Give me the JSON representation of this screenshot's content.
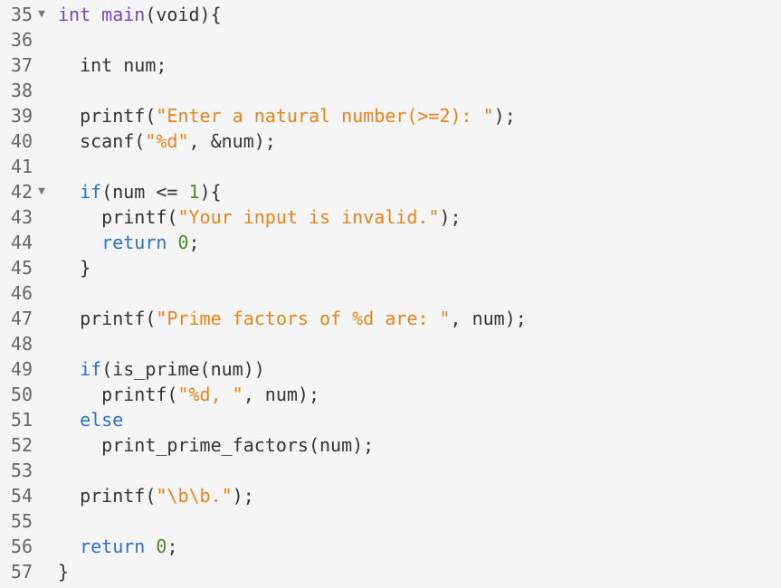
{
  "colors": {
    "background": "#f5f5f5",
    "gutter_text": "#666666",
    "plain": "#333333",
    "keyword": "#7b46b8",
    "control": "#2b72c8",
    "string": "#e8831c",
    "number": "#4d8a2c"
  },
  "fold_icon": "triangle-down-icon",
  "lines": [
    {
      "n": "35",
      "fold": "▼",
      "tokens": [
        {
          "t": "int",
          "c": "kw"
        },
        {
          "t": " ",
          "c": "pl"
        },
        {
          "t": "main",
          "c": "fn"
        },
        {
          "t": "(void){",
          "c": "pl"
        }
      ]
    },
    {
      "n": "36",
      "fold": "",
      "tokens": []
    },
    {
      "n": "37",
      "fold": "",
      "tokens": [
        {
          "t": "  int num;",
          "c": "pl"
        }
      ]
    },
    {
      "n": "38",
      "fold": "",
      "tokens": []
    },
    {
      "n": "39",
      "fold": "",
      "tokens": [
        {
          "t": "  printf(",
          "c": "pl"
        },
        {
          "t": "\"Enter a natural number(>=2): \"",
          "c": "str"
        },
        {
          "t": ");",
          "c": "pl"
        }
      ]
    },
    {
      "n": "40",
      "fold": "",
      "tokens": [
        {
          "t": "  scanf(",
          "c": "pl"
        },
        {
          "t": "\"%d\"",
          "c": "str"
        },
        {
          "t": ", &num);",
          "c": "pl"
        }
      ]
    },
    {
      "n": "41",
      "fold": "",
      "tokens": []
    },
    {
      "n": "42",
      "fold": "▼",
      "tokens": [
        {
          "t": "  ",
          "c": "pl"
        },
        {
          "t": "if",
          "c": "blue"
        },
        {
          "t": "(num <= ",
          "c": "pl"
        },
        {
          "t": "1",
          "c": "num"
        },
        {
          "t": "){",
          "c": "pl"
        }
      ]
    },
    {
      "n": "43",
      "fold": "",
      "tokens": [
        {
          "t": "    printf(",
          "c": "pl"
        },
        {
          "t": "\"Your input is invalid.\"",
          "c": "str"
        },
        {
          "t": ");",
          "c": "pl"
        }
      ]
    },
    {
      "n": "44",
      "fold": "",
      "tokens": [
        {
          "t": "    ",
          "c": "pl"
        },
        {
          "t": "return",
          "c": "blue"
        },
        {
          "t": " ",
          "c": "pl"
        },
        {
          "t": "0",
          "c": "num"
        },
        {
          "t": ";",
          "c": "pl"
        }
      ]
    },
    {
      "n": "45",
      "fold": "",
      "tokens": [
        {
          "t": "  }",
          "c": "pl"
        }
      ]
    },
    {
      "n": "46",
      "fold": "",
      "tokens": []
    },
    {
      "n": "47",
      "fold": "",
      "tokens": [
        {
          "t": "  printf(",
          "c": "pl"
        },
        {
          "t": "\"Prime factors of %d are: \"",
          "c": "str"
        },
        {
          "t": ", num);",
          "c": "pl"
        }
      ]
    },
    {
      "n": "48",
      "fold": "",
      "tokens": []
    },
    {
      "n": "49",
      "fold": "",
      "tokens": [
        {
          "t": "  ",
          "c": "pl"
        },
        {
          "t": "if",
          "c": "blue"
        },
        {
          "t": "(is_prime(num))",
          "c": "pl"
        }
      ]
    },
    {
      "n": "50",
      "fold": "",
      "tokens": [
        {
          "t": "    printf(",
          "c": "pl"
        },
        {
          "t": "\"%d, \"",
          "c": "str"
        },
        {
          "t": ", num);",
          "c": "pl"
        }
      ]
    },
    {
      "n": "51",
      "fold": "",
      "tokens": [
        {
          "t": "  ",
          "c": "pl"
        },
        {
          "t": "else",
          "c": "blue"
        }
      ]
    },
    {
      "n": "52",
      "fold": "",
      "tokens": [
        {
          "t": "    print_prime_factors(num);",
          "c": "pl"
        }
      ]
    },
    {
      "n": "53",
      "fold": "",
      "tokens": []
    },
    {
      "n": "54",
      "fold": "",
      "tokens": [
        {
          "t": "  printf(",
          "c": "pl"
        },
        {
          "t": "\"\\b\\b.\"",
          "c": "str"
        },
        {
          "t": ");",
          "c": "pl"
        }
      ]
    },
    {
      "n": "55",
      "fold": "",
      "tokens": []
    },
    {
      "n": "56",
      "fold": "",
      "tokens": [
        {
          "t": "  ",
          "c": "pl"
        },
        {
          "t": "return",
          "c": "blue"
        },
        {
          "t": " ",
          "c": "pl"
        },
        {
          "t": "0",
          "c": "num"
        },
        {
          "t": ";",
          "c": "pl"
        }
      ]
    },
    {
      "n": "57",
      "fold": "",
      "tokens": [
        {
          "t": "}",
          "c": "pl"
        }
      ]
    }
  ]
}
